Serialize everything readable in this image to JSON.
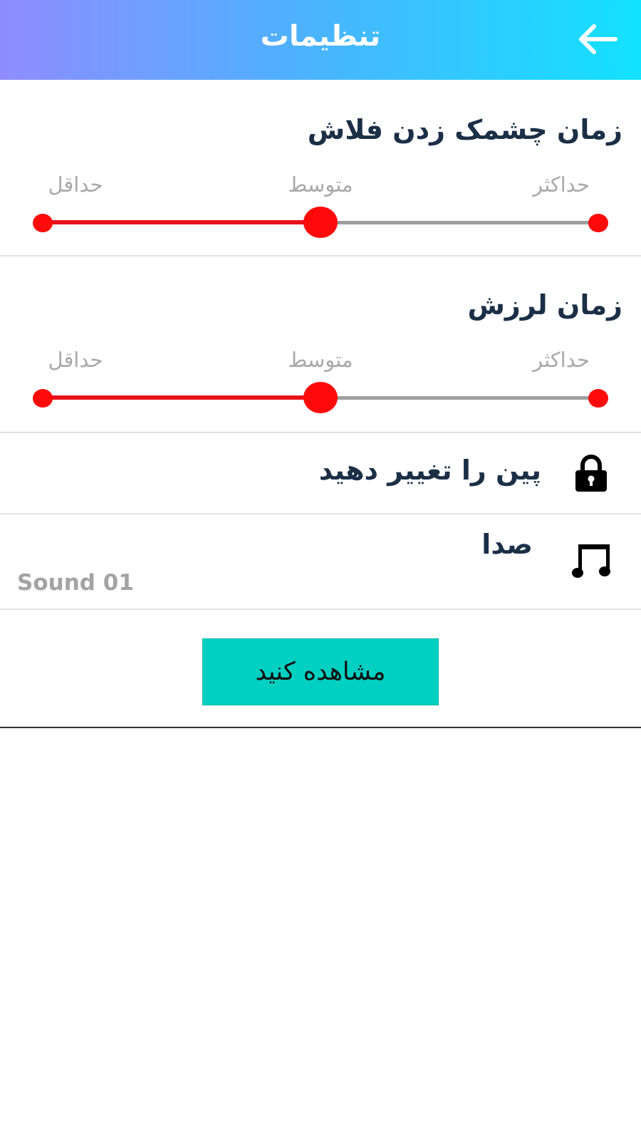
{
  "header": {
    "title": "تنظیمات",
    "back_icon": "arrow-left-icon",
    "gradient_colors": [
      "#8f8cff",
      "#4fb0ff",
      "#12e2ff"
    ]
  },
  "flash_blink": {
    "title": "زمان چشمک زدن فلاش",
    "min_label": "حداقل",
    "mid_label": "متوسط",
    "max_label": "حداکثر",
    "value_fraction": 0.5
  },
  "vibration": {
    "title": "زمان لرزش",
    "min_label": "حداقل",
    "mid_label": "متوسط",
    "max_label": "حداکثر",
    "value_fraction": 0.5
  },
  "pin_row": {
    "label": "پین را تغییر دهید",
    "icon": "lock-icon"
  },
  "sound_row": {
    "label": "صدا",
    "value": "Sound 01",
    "icon": "music-note-icon"
  },
  "action_button": {
    "label": "مشاهده کنید",
    "color": "#00d0c1"
  },
  "colors": {
    "slider_active": "#ff0a0a",
    "slider_inactive": "#9e9e9e",
    "title_text": "#1b2f47"
  }
}
